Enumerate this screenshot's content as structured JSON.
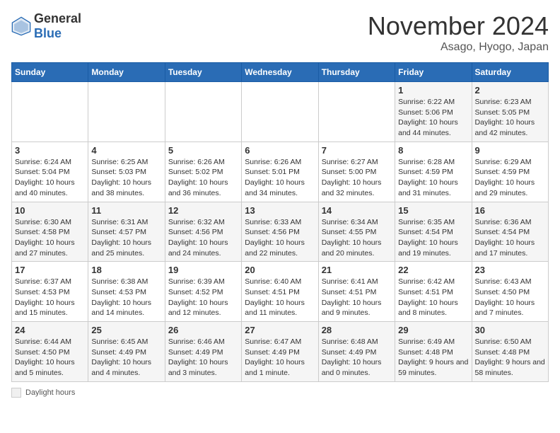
{
  "header": {
    "logo_general": "General",
    "logo_blue": "Blue",
    "month": "November 2024",
    "location": "Asago, Hyogo, Japan"
  },
  "days_of_week": [
    "Sunday",
    "Monday",
    "Tuesday",
    "Wednesday",
    "Thursday",
    "Friday",
    "Saturday"
  ],
  "legend": {
    "label": "Daylight hours"
  },
  "weeks": [
    [
      {
        "day": "",
        "info": ""
      },
      {
        "day": "",
        "info": ""
      },
      {
        "day": "",
        "info": ""
      },
      {
        "day": "",
        "info": ""
      },
      {
        "day": "",
        "info": ""
      },
      {
        "day": "1",
        "info": "Sunrise: 6:22 AM\nSunset: 5:06 PM\nDaylight: 10 hours and 44 minutes."
      },
      {
        "day": "2",
        "info": "Sunrise: 6:23 AM\nSunset: 5:05 PM\nDaylight: 10 hours and 42 minutes."
      }
    ],
    [
      {
        "day": "3",
        "info": "Sunrise: 6:24 AM\nSunset: 5:04 PM\nDaylight: 10 hours and 40 minutes."
      },
      {
        "day": "4",
        "info": "Sunrise: 6:25 AM\nSunset: 5:03 PM\nDaylight: 10 hours and 38 minutes."
      },
      {
        "day": "5",
        "info": "Sunrise: 6:26 AM\nSunset: 5:02 PM\nDaylight: 10 hours and 36 minutes."
      },
      {
        "day": "6",
        "info": "Sunrise: 6:26 AM\nSunset: 5:01 PM\nDaylight: 10 hours and 34 minutes."
      },
      {
        "day": "7",
        "info": "Sunrise: 6:27 AM\nSunset: 5:00 PM\nDaylight: 10 hours and 32 minutes."
      },
      {
        "day": "8",
        "info": "Sunrise: 6:28 AM\nSunset: 4:59 PM\nDaylight: 10 hours and 31 minutes."
      },
      {
        "day": "9",
        "info": "Sunrise: 6:29 AM\nSunset: 4:59 PM\nDaylight: 10 hours and 29 minutes."
      }
    ],
    [
      {
        "day": "10",
        "info": "Sunrise: 6:30 AM\nSunset: 4:58 PM\nDaylight: 10 hours and 27 minutes."
      },
      {
        "day": "11",
        "info": "Sunrise: 6:31 AM\nSunset: 4:57 PM\nDaylight: 10 hours and 25 minutes."
      },
      {
        "day": "12",
        "info": "Sunrise: 6:32 AM\nSunset: 4:56 PM\nDaylight: 10 hours and 24 minutes."
      },
      {
        "day": "13",
        "info": "Sunrise: 6:33 AM\nSunset: 4:56 PM\nDaylight: 10 hours and 22 minutes."
      },
      {
        "day": "14",
        "info": "Sunrise: 6:34 AM\nSunset: 4:55 PM\nDaylight: 10 hours and 20 minutes."
      },
      {
        "day": "15",
        "info": "Sunrise: 6:35 AM\nSunset: 4:54 PM\nDaylight: 10 hours and 19 minutes."
      },
      {
        "day": "16",
        "info": "Sunrise: 6:36 AM\nSunset: 4:54 PM\nDaylight: 10 hours and 17 minutes."
      }
    ],
    [
      {
        "day": "17",
        "info": "Sunrise: 6:37 AM\nSunset: 4:53 PM\nDaylight: 10 hours and 15 minutes."
      },
      {
        "day": "18",
        "info": "Sunrise: 6:38 AM\nSunset: 4:53 PM\nDaylight: 10 hours and 14 minutes."
      },
      {
        "day": "19",
        "info": "Sunrise: 6:39 AM\nSunset: 4:52 PM\nDaylight: 10 hours and 12 minutes."
      },
      {
        "day": "20",
        "info": "Sunrise: 6:40 AM\nSunset: 4:51 PM\nDaylight: 10 hours and 11 minutes."
      },
      {
        "day": "21",
        "info": "Sunrise: 6:41 AM\nSunset: 4:51 PM\nDaylight: 10 hours and 9 minutes."
      },
      {
        "day": "22",
        "info": "Sunrise: 6:42 AM\nSunset: 4:51 PM\nDaylight: 10 hours and 8 minutes."
      },
      {
        "day": "23",
        "info": "Sunrise: 6:43 AM\nSunset: 4:50 PM\nDaylight: 10 hours and 7 minutes."
      }
    ],
    [
      {
        "day": "24",
        "info": "Sunrise: 6:44 AM\nSunset: 4:50 PM\nDaylight: 10 hours and 5 minutes."
      },
      {
        "day": "25",
        "info": "Sunrise: 6:45 AM\nSunset: 4:49 PM\nDaylight: 10 hours and 4 minutes."
      },
      {
        "day": "26",
        "info": "Sunrise: 6:46 AM\nSunset: 4:49 PM\nDaylight: 10 hours and 3 minutes."
      },
      {
        "day": "27",
        "info": "Sunrise: 6:47 AM\nSunset: 4:49 PM\nDaylight: 10 hours and 1 minute."
      },
      {
        "day": "28",
        "info": "Sunrise: 6:48 AM\nSunset: 4:49 PM\nDaylight: 10 hours and 0 minutes."
      },
      {
        "day": "29",
        "info": "Sunrise: 6:49 AM\nSunset: 4:48 PM\nDaylight: 9 hours and 59 minutes."
      },
      {
        "day": "30",
        "info": "Sunrise: 6:50 AM\nSunset: 4:48 PM\nDaylight: 9 hours and 58 minutes."
      }
    ]
  ]
}
